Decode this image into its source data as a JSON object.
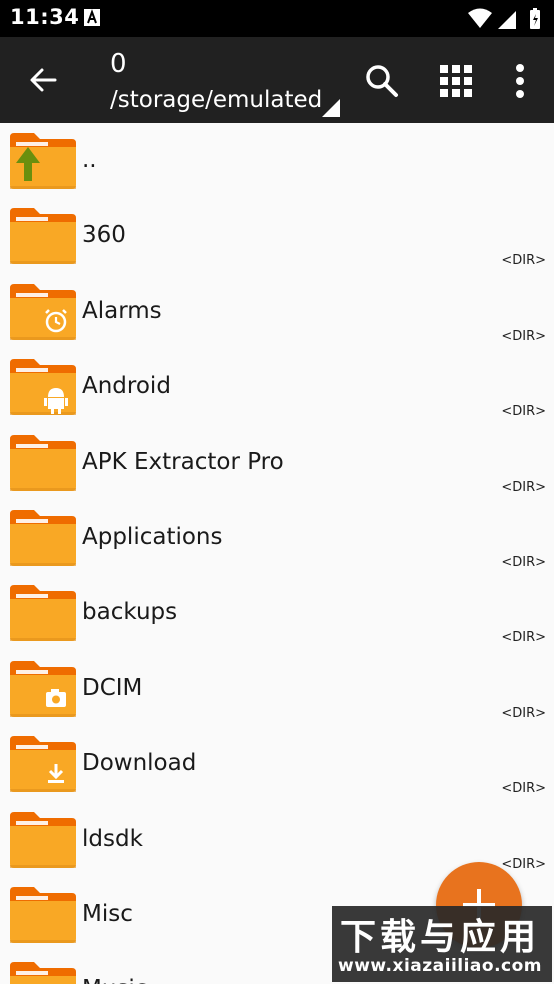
{
  "status_bar": {
    "time": "11:34"
  },
  "toolbar": {
    "count": "0",
    "path": "/storage/emulated",
    "icons": [
      "back-arrow-icon",
      "search-icon",
      "grid-view-icon",
      "more-vert-icon"
    ]
  },
  "files": [
    {
      "name": "..",
      "type": "",
      "icon": "folder-up-icon"
    },
    {
      "name": "360",
      "type": "<DIR>",
      "icon": "folder-icon"
    },
    {
      "name": "Alarms",
      "type": "<DIR>",
      "icon": "folder-alarm-icon"
    },
    {
      "name": "Android",
      "type": "<DIR>",
      "icon": "folder-android-icon"
    },
    {
      "name": "APK Extractor Pro",
      "type": "<DIR>",
      "icon": "folder-icon"
    },
    {
      "name": "Applications",
      "type": "<DIR>",
      "icon": "folder-icon"
    },
    {
      "name": "backups",
      "type": "<DIR>",
      "icon": "folder-icon"
    },
    {
      "name": "DCIM",
      "type": "<DIR>",
      "icon": "folder-camera-icon"
    },
    {
      "name": "Download",
      "type": "<DIR>",
      "icon": "folder-download-icon"
    },
    {
      "name": "ldsdk",
      "type": "<DIR>",
      "icon": "folder-icon"
    },
    {
      "name": "Misc",
      "type": "",
      "icon": "folder-icon"
    },
    {
      "name": "Music",
      "type": "",
      "icon": "folder-icon"
    }
  ],
  "fab": {
    "icon": "plus-icon"
  },
  "watermark": {
    "title": "下载与应用",
    "url": "www.xiazaiiliao.com"
  },
  "colors": {
    "folder": "#f9a825",
    "folder_tab": "#ef6c00",
    "toolbar": "#212121",
    "fab": "#e8731e"
  }
}
